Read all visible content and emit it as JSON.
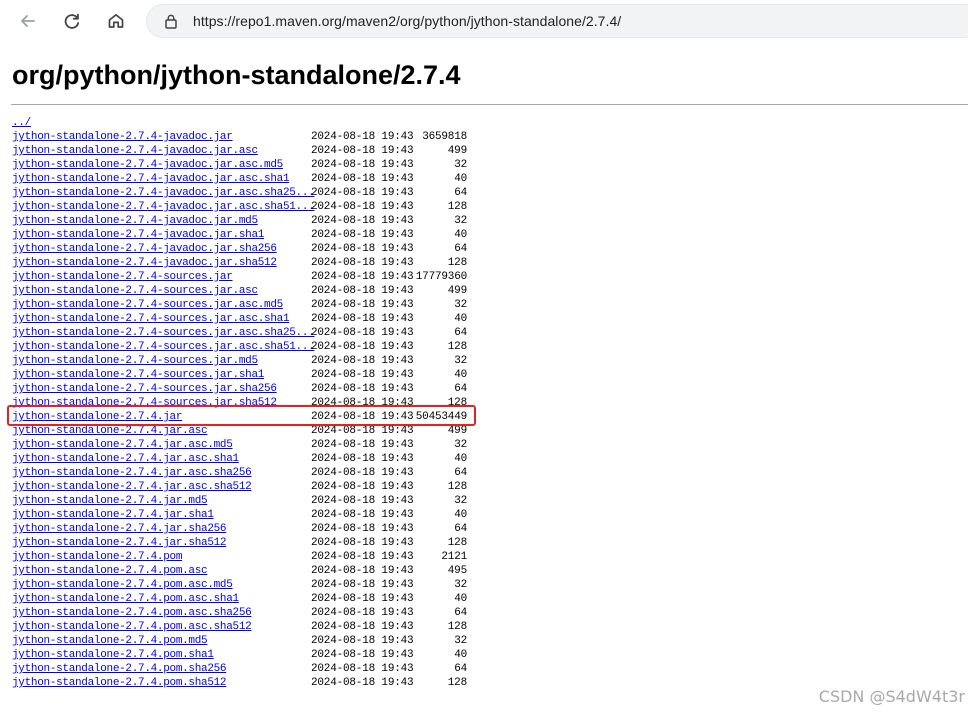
{
  "browser": {
    "url": "https://repo1.maven.org/maven2/org/python/jython-standalone/2.7.4/",
    "icons": {
      "back": "back-icon",
      "refresh": "refresh-icon",
      "home": "home-icon",
      "lock": "lock-icon"
    }
  },
  "page": {
    "title": "org/python/jython-standalone/2.7.4",
    "parent_link": "../",
    "rows": [
      {
        "name": "jython-standalone-2.7.4-javadoc.jar",
        "date": "2024-08-18 19:43",
        "size": "3659818"
      },
      {
        "name": "jython-standalone-2.7.4-javadoc.jar.asc",
        "date": "2024-08-18 19:43",
        "size": "499"
      },
      {
        "name": "jython-standalone-2.7.4-javadoc.jar.asc.md5",
        "date": "2024-08-18 19:43",
        "size": "32"
      },
      {
        "name": "jython-standalone-2.7.4-javadoc.jar.asc.sha1",
        "date": "2024-08-18 19:43",
        "size": "40"
      },
      {
        "name": "jython-standalone-2.7.4-javadoc.jar.asc.sha25...",
        "date": "2024-08-18 19:43",
        "size": "64"
      },
      {
        "name": "jython-standalone-2.7.4-javadoc.jar.asc.sha51...",
        "date": "2024-08-18 19:43",
        "size": "128"
      },
      {
        "name": "jython-standalone-2.7.4-javadoc.jar.md5",
        "date": "2024-08-18 19:43",
        "size": "32"
      },
      {
        "name": "jython-standalone-2.7.4-javadoc.jar.sha1",
        "date": "2024-08-18 19:43",
        "size": "40"
      },
      {
        "name": "jython-standalone-2.7.4-javadoc.jar.sha256",
        "date": "2024-08-18 19:43",
        "size": "64"
      },
      {
        "name": "jython-standalone-2.7.4-javadoc.jar.sha512",
        "date": "2024-08-18 19:43",
        "size": "128"
      },
      {
        "name": "jython-standalone-2.7.4-sources.jar",
        "date": "2024-08-18 19:43",
        "size": "17779360"
      },
      {
        "name": "jython-standalone-2.7.4-sources.jar.asc",
        "date": "2024-08-18 19:43",
        "size": "499"
      },
      {
        "name": "jython-standalone-2.7.4-sources.jar.asc.md5",
        "date": "2024-08-18 19:43",
        "size": "32"
      },
      {
        "name": "jython-standalone-2.7.4-sources.jar.asc.sha1",
        "date": "2024-08-18 19:43",
        "size": "40"
      },
      {
        "name": "jython-standalone-2.7.4-sources.jar.asc.sha25...",
        "date": "2024-08-18 19:43",
        "size": "64"
      },
      {
        "name": "jython-standalone-2.7.4-sources.jar.asc.sha51...",
        "date": "2024-08-18 19:43",
        "size": "128"
      },
      {
        "name": "jython-standalone-2.7.4-sources.jar.md5",
        "date": "2024-08-18 19:43",
        "size": "32"
      },
      {
        "name": "jython-standalone-2.7.4-sources.jar.sha1",
        "date": "2024-08-18 19:43",
        "size": "40"
      },
      {
        "name": "jython-standalone-2.7.4-sources.jar.sha256",
        "date": "2024-08-18 19:43",
        "size": "64"
      },
      {
        "name": "jython-standalone-2.7.4-sources.jar.sha512",
        "date": "2024-08-18 19:43",
        "size": "128"
      },
      {
        "name": "jython-standalone-2.7.4.jar",
        "date": "2024-08-18 19:43",
        "size": "50453449"
      },
      {
        "name": "jython-standalone-2.7.4.jar.asc",
        "date": "2024-08-18 19:43",
        "size": "499"
      },
      {
        "name": "jython-standalone-2.7.4.jar.asc.md5",
        "date": "2024-08-18 19:43",
        "size": "32"
      },
      {
        "name": "jython-standalone-2.7.4.jar.asc.sha1",
        "date": "2024-08-18 19:43",
        "size": "40"
      },
      {
        "name": "jython-standalone-2.7.4.jar.asc.sha256",
        "date": "2024-08-18 19:43",
        "size": "64"
      },
      {
        "name": "jython-standalone-2.7.4.jar.asc.sha512",
        "date": "2024-08-18 19:43",
        "size": "128"
      },
      {
        "name": "jython-standalone-2.7.4.jar.md5",
        "date": "2024-08-18 19:43",
        "size": "32"
      },
      {
        "name": "jython-standalone-2.7.4.jar.sha1",
        "date": "2024-08-18 19:43",
        "size": "40"
      },
      {
        "name": "jython-standalone-2.7.4.jar.sha256",
        "date": "2024-08-18 19:43",
        "size": "64"
      },
      {
        "name": "jython-standalone-2.7.4.jar.sha512",
        "date": "2024-08-18 19:43",
        "size": "128"
      },
      {
        "name": "jython-standalone-2.7.4.pom",
        "date": "2024-08-18 19:43",
        "size": "2121"
      },
      {
        "name": "jython-standalone-2.7.4.pom.asc",
        "date": "2024-08-18 19:43",
        "size": "495"
      },
      {
        "name": "jython-standalone-2.7.4.pom.asc.md5",
        "date": "2024-08-18 19:43",
        "size": "32"
      },
      {
        "name": "jython-standalone-2.7.4.pom.asc.sha1",
        "date": "2024-08-18 19:43",
        "size": "40"
      },
      {
        "name": "jython-standalone-2.7.4.pom.asc.sha256",
        "date": "2024-08-18 19:43",
        "size": "64"
      },
      {
        "name": "jython-standalone-2.7.4.pom.asc.sha512",
        "date": "2024-08-18 19:43",
        "size": "128"
      },
      {
        "name": "jython-standalone-2.7.4.pom.md5",
        "date": "2024-08-18 19:43",
        "size": "32"
      },
      {
        "name": "jython-standalone-2.7.4.pom.sha1",
        "date": "2024-08-18 19:43",
        "size": "40"
      },
      {
        "name": "jython-standalone-2.7.4.pom.sha256",
        "date": "2024-08-18 19:43",
        "size": "64"
      },
      {
        "name": "jython-standalone-2.7.4.pom.sha512",
        "date": "2024-08-18 19:43",
        "size": "128"
      }
    ]
  },
  "overlay": {
    "highlight_color": "#e52222",
    "watermark": "CSDN @S4dW4t3r"
  }
}
